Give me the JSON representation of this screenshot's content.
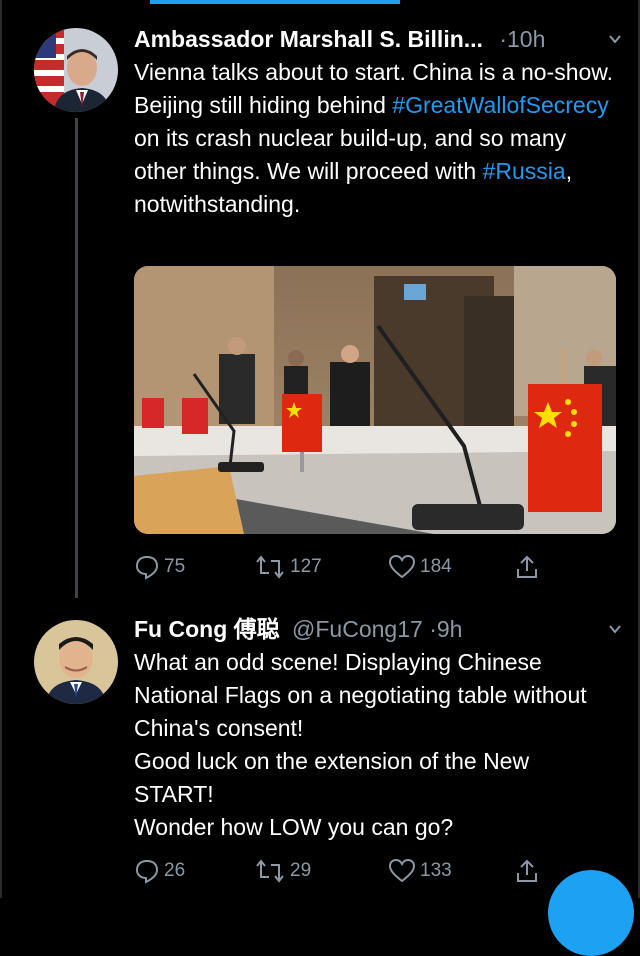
{
  "colors": {
    "accent": "#1d9bf0",
    "muted": "#8b98a5",
    "background": "#000000"
  },
  "tweets": [
    {
      "author_name": "Ambassador Marshall S. Billin...",
      "handle": "",
      "separator": "·",
      "time": "10h",
      "text_segments": [
        {
          "text": "Vienna talks about to start. China is a no-show. Beijing still hiding behind ",
          "type": "plain"
        },
        {
          "text": "#GreatWallofSecrecy",
          "type": "hashtag"
        },
        {
          "text": " on its crash nuclear build-up, and so many other things. We will proceed with ",
          "type": "plain"
        },
        {
          "text": "#Russia",
          "type": "hashtag"
        },
        {
          "text": ", notwithstanding.",
          "type": "plain"
        }
      ],
      "media": {
        "description": "photo",
        "icon": "negotiating-table-photo"
      },
      "stats": {
        "replies": "75",
        "retweets": "127",
        "likes": "184"
      }
    },
    {
      "author_name": "Fu Cong 傅聪",
      "handle": "@FuCong17",
      "separator": "·",
      "time": "9h",
      "lines": [
        "What an odd scene! Displaying Chinese National Flags on a negotiating table without China's consent!",
        "Good luck on the extension of the New START!",
        "Wonder how LOW you can go?"
      ],
      "stats": {
        "replies": "26",
        "retweets": "29",
        "likes": "133"
      }
    }
  ]
}
